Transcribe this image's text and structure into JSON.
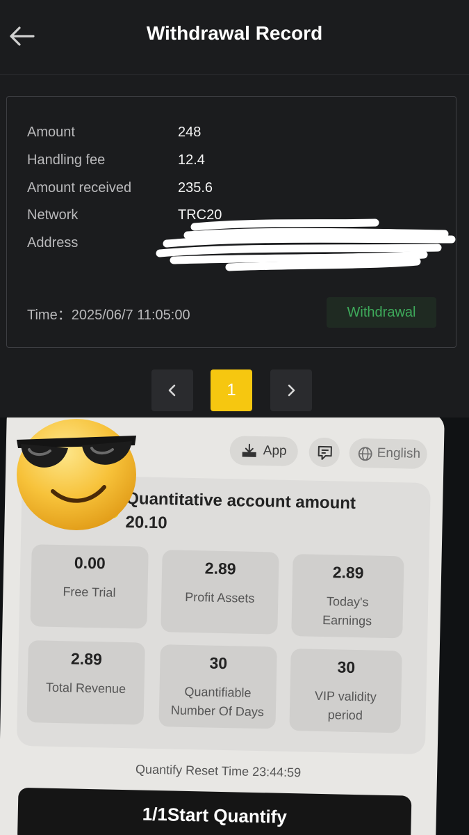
{
  "header": {
    "title": "Withdrawal Record",
    "back_icon": "arrow-left-icon"
  },
  "record": {
    "rows": [
      {
        "label": "Amount",
        "value": "248"
      },
      {
        "label": "Handling fee",
        "value": "12.4"
      },
      {
        "label": "Amount received",
        "value": "235.6"
      },
      {
        "label": "Network",
        "value": "TRC20"
      },
      {
        "label": "Address",
        "value": ""
      }
    ],
    "time": "Time：2025/06/7 11:05:00",
    "status": "Withdrawal",
    "status_color": "#3eaa5b"
  },
  "pagination": {
    "current": "1",
    "prev_icon": "chevron-left-icon",
    "next_icon": "chevron-right-icon",
    "accent": "#f6c710"
  },
  "phone": {
    "top_bar": {
      "app_label": "App",
      "language_label": "English"
    },
    "account": {
      "title": "Quantitative account amount",
      "amount": "20.10"
    },
    "stats": [
      {
        "value": "0.00",
        "label": "Free Trial"
      },
      {
        "value": "2.89",
        "label": "Profit Assets"
      },
      {
        "value": "2.89",
        "label": "Today's Earnings"
      },
      {
        "value": "2.89",
        "label": "Total Revenue"
      },
      {
        "value": "30",
        "label": "Quantifiable Number Of Days"
      },
      {
        "value": "30",
        "label": "VIP validity period"
      }
    ],
    "reset_time": "Quantify Reset Time 23:44:59",
    "start_button": "1/1Start Quantify"
  },
  "overlay": {
    "emoji": "sunglasses-emoji"
  }
}
